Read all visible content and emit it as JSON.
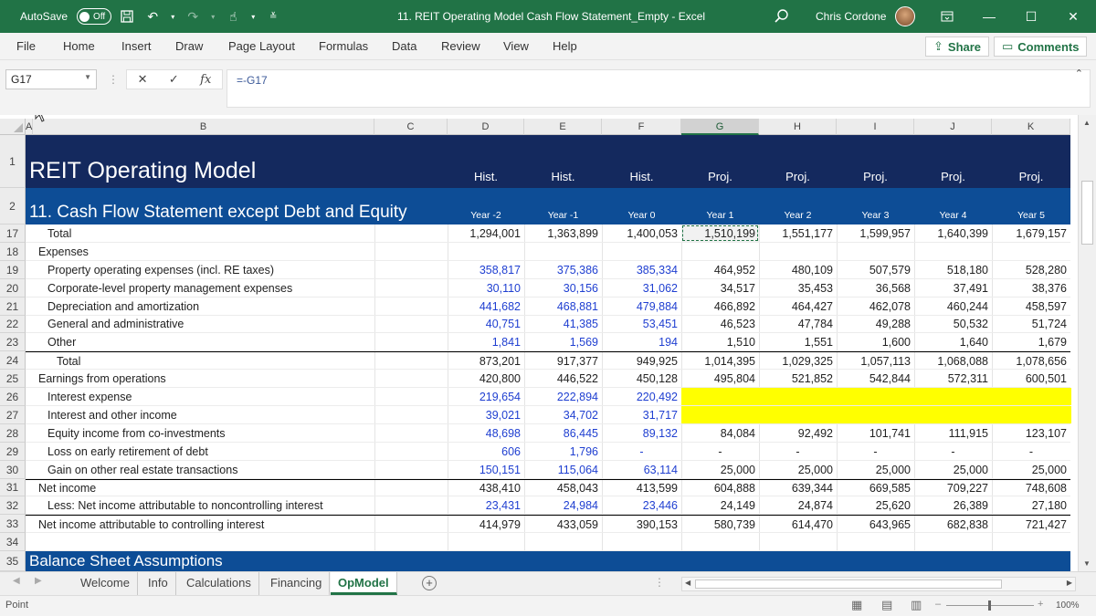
{
  "titlebar": {
    "autosave_label": "AutoSave",
    "autosave_state": "Off",
    "doc_title": "11. REIT Operating Model Cash Flow Statement_Empty  -  Excel",
    "user_name": "Chris Cordone"
  },
  "ribbon": {
    "tabs": [
      "File",
      "Home",
      "Insert",
      "Draw",
      "Page Layout",
      "Formulas",
      "Data",
      "Review",
      "View",
      "Help"
    ],
    "share_label": "Share",
    "comments_label": "Comments"
  },
  "formula_bar": {
    "name_box": "G17",
    "formula": "=-G17"
  },
  "columns": [
    "A",
    "B",
    "C",
    "D",
    "E",
    "F",
    "G",
    "H",
    "I",
    "J",
    "K"
  ],
  "selected_column": "G",
  "header": {
    "title": "REIT Operating Model",
    "section": "11. Cash Flow Statement except Debt and Equity",
    "period_types": [
      "Hist.",
      "Hist.",
      "Hist.",
      "Proj.",
      "Proj.",
      "Proj.",
      "Proj.",
      "Proj."
    ],
    "period_years": [
      "Year -2",
      "Year -1",
      "Year 0",
      "Year 1",
      "Year 2",
      "Year 3",
      "Year 4",
      "Year 5"
    ]
  },
  "rows": [
    {
      "n": "17",
      "label": "Total",
      "indent": 1,
      "values": [
        "1,294,001",
        "1,363,899",
        "1,400,053",
        "1,510,199",
        "1,551,177",
        "1,599,957",
        "1,640,399",
        "1,679,157"
      ],
      "hist_blue": false
    },
    {
      "n": "18",
      "label": "Expenses",
      "indent": 0,
      "values": [
        "",
        "",
        "",
        "",
        "",
        "",
        "",
        ""
      ],
      "hist_blue": false
    },
    {
      "n": "19",
      "label": "Property operating expenses (incl. RE taxes)",
      "indent": 1,
      "values": [
        "358,817",
        "375,386",
        "385,334",
        "464,952",
        "480,109",
        "507,579",
        "518,180",
        "528,280"
      ],
      "hist_blue": true
    },
    {
      "n": "20",
      "label": "Corporate-level property management expenses",
      "indent": 1,
      "values": [
        "30,110",
        "30,156",
        "31,062",
        "34,517",
        "35,453",
        "36,568",
        "37,491",
        "38,376"
      ],
      "hist_blue": true
    },
    {
      "n": "21",
      "label": "Depreciation and amortization",
      "indent": 1,
      "values": [
        "441,682",
        "468,881",
        "479,884",
        "466,892",
        "464,427",
        "462,078",
        "460,244",
        "458,597"
      ],
      "hist_blue": true
    },
    {
      "n": "22",
      "label": "General and administrative",
      "indent": 1,
      "values": [
        "40,751",
        "41,385",
        "53,451",
        "46,523",
        "47,784",
        "49,288",
        "50,532",
        "51,724"
      ],
      "hist_blue": true
    },
    {
      "n": "23",
      "label": "Other",
      "indent": 1,
      "values": [
        "1,841",
        "1,569",
        "194",
        "1,510",
        "1,551",
        "1,600",
        "1,640",
        "1,679"
      ],
      "hist_blue": true
    },
    {
      "n": "24",
      "label": "Total",
      "indent": 2,
      "values": [
        "873,201",
        "917,377",
        "949,925",
        "1,014,395",
        "1,029,325",
        "1,057,113",
        "1,068,088",
        "1,078,656"
      ],
      "hist_blue": false
    },
    {
      "n": "25",
      "label": "Earnings from operations",
      "indent": 0,
      "values": [
        "420,800",
        "446,522",
        "450,128",
        "495,804",
        "521,852",
        "542,844",
        "572,311",
        "600,501"
      ],
      "hist_blue": false
    },
    {
      "n": "26",
      "label": "Interest expense",
      "indent": 1,
      "values": [
        "219,654",
        "222,894",
        "220,492",
        "",
        "",
        "",
        "",
        ""
      ],
      "hist_blue": true
    },
    {
      "n": "27",
      "label": "Interest and other income",
      "indent": 1,
      "values": [
        "39,021",
        "34,702",
        "31,717",
        "",
        "",
        "",
        "",
        ""
      ],
      "hist_blue": true
    },
    {
      "n": "28",
      "label": "Equity income from co-investments",
      "indent": 1,
      "values": [
        "48,698",
        "86,445",
        "89,132",
        "84,084",
        "92,492",
        "101,741",
        "111,915",
        "123,107"
      ],
      "hist_blue": true
    },
    {
      "n": "29",
      "label": "Loss on early retirement of debt",
      "indent": 1,
      "values": [
        "606",
        "1,796",
        "-",
        "-",
        "-",
        "-",
        "-",
        "-"
      ],
      "hist_blue": true
    },
    {
      "n": "30",
      "label": "Gain on other real estate transactions",
      "indent": 1,
      "values": [
        "150,151",
        "115,064",
        "63,114",
        "25,000",
        "25,000",
        "25,000",
        "25,000",
        "25,000"
      ],
      "hist_blue": true
    },
    {
      "n": "31",
      "label": "Net income",
      "indent": 0,
      "values": [
        "438,410",
        "458,043",
        "413,599",
        "604,888",
        "639,344",
        "669,585",
        "709,227",
        "748,608"
      ],
      "hist_blue": false
    },
    {
      "n": "32",
      "label": "Less: Net income attributable to noncontrolling interest",
      "indent": 1,
      "values": [
        "23,431",
        "24,984",
        "23,446",
        "24,149",
        "24,874",
        "25,620",
        "26,389",
        "27,180"
      ],
      "hist_blue": true
    },
    {
      "n": "33",
      "label": "Net income attributable to controlling interest",
      "indent": 0,
      "values": [
        "414,979",
        "433,059",
        "390,153",
        "580,739",
        "614,470",
        "643,965",
        "682,838",
        "721,427"
      ],
      "hist_blue": false
    },
    {
      "n": "34",
      "label": "",
      "indent": 0,
      "values": [
        "",
        "",
        "",
        "",
        "",
        "",
        "",
        ""
      ],
      "hist_blue": false
    }
  ],
  "balance_row": {
    "n": "35",
    "label": "Balance Sheet Assumptions"
  },
  "sheet_tabs": [
    "Welcome",
    "Info",
    "Calculations",
    "Financing",
    "OpModel"
  ],
  "active_sheet": "OpModel",
  "status": {
    "mode": "Point",
    "zoom": "100%"
  },
  "colors": {
    "excel_green": "#217346",
    "navy": "#14295e",
    "section_blue": "#0d4d96",
    "input_blue": "#1f3fd1",
    "highlight_yellow": "#ffff00"
  }
}
